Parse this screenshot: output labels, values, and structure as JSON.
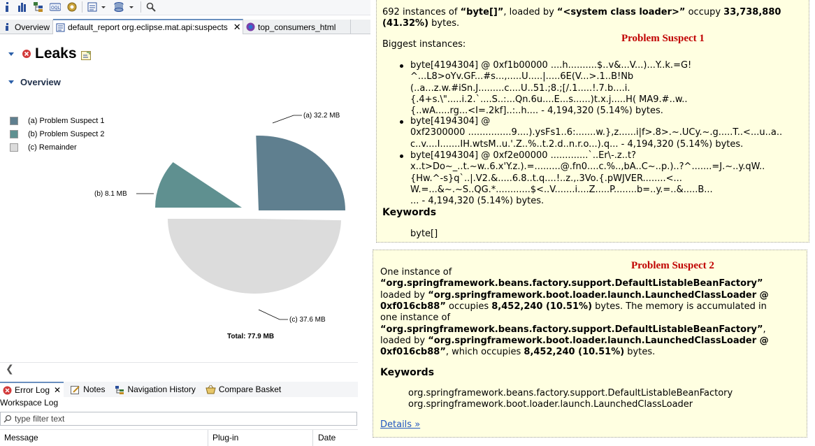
{
  "editor_tabs": {
    "overview": "Overview",
    "report": "default_report org.eclipse.mat.api:suspects",
    "consumers": "top_consumers_html"
  },
  "leaks": {
    "title": "Leaks",
    "overview": "Overview"
  },
  "legend": [
    {
      "label": "(a)  Problem Suspect 1",
      "color": "#5f7f8f"
    },
    {
      "label": "(b)  Problem Suspect 2",
      "color": "#5f9090"
    },
    {
      "label": "(c)  Remainder",
      "color": "#dcdcdc"
    }
  ],
  "chart_data": {
    "type": "pie",
    "slices": [
      {
        "label": "(a)  32.2 MB",
        "value": 32.2,
        "color": "#5f7f8f"
      },
      {
        "label": "(b)  8.1 MB",
        "value": 8.1,
        "color": "#5f9090"
      },
      {
        "label": "(c)  37.6 MB",
        "value": 37.6,
        "color": "#dcdcdc"
      }
    ],
    "total": "Total: 77.9 MB"
  },
  "bottom_tabs": {
    "error_log": "Error Log",
    "notes": "Notes",
    "nav_history": "Navigation History",
    "compare_basket": "Compare Basket"
  },
  "workspace_log": "Workspace Log",
  "filter_placeholder": "type filter text",
  "log_columns": {
    "message": "Message",
    "plugin": "Plug-in",
    "date": "Date"
  },
  "suspect1": {
    "label": "Problem Suspect 1",
    "intro_a": "692 instances of ",
    "intro_cls": "“byte[]”",
    "intro_b": ", loaded by ",
    "intro_loader": "“<system class loader>”",
    "intro_c": " occupy ",
    "intro_size": "33,738,880",
    "intro_pct": "(41.32%)",
    "intro_d": " bytes.",
    "biggest": "Biggest instances:",
    "instances": [
      [
        "byte[4194304] @ 0xf1b00000 ....h..........$..v&...V...)...Y..k.=G!",
        "^...L8>oYv.GF...#s...,.....U.....|.....6E(V...>.1..B!Nb",
        "(..a...z.w.#iSn.J.........c....U..51.;8.;[/.1.....!.7.b....i.",
        "{.4+s.\\\".....i.2.`....S..:...Qn.6u....E...s......)t.x.j.....H( MA9.#..w..",
        "{..wA.....rg...<I=.2kf]..:..h.... - 4,194,320 (5.14%) bytes."
      ],
      [
        "byte[4194304] @",
        "0xf2300000 ...............9....).ysFs1..6:.......w.},z......i|f>.8>.~.UCy.~.g.....T..<...u..a..",
        "c..v....I.......IH.wtsM..u.'.Z..%..t.2.d..n.r.o...).q... - 4,194,320 (5.14%) bytes."
      ],
      [
        "byte[4194304] @ 0xf2e00000 .............`..Er\\-.z..t?",
        "x..t>Do~_..t.~w..6.x'Y.z.).=.........@.fn0....c.%..,bA..C~..p.)..?^.......=J.~..y.qW..",
        "{Hw.^-s}q`..|.V2.&.....6.8..t.q....!..z.,.3Vo.{.pWJVER........<...",
        "W.=...&~.~S..QG.*............$<..V.......i....Z.....P........b=..y.=..&.....B...",
        "... - 4,194,320 (5.14%) bytes."
      ]
    ],
    "keywords_title": "Keywords",
    "keywords": [
      "byte[]"
    ]
  },
  "suspect2": {
    "label": "Problem Suspect 2",
    "lines": [
      {
        "parts": [
          {
            "t": "One instance of",
            "b": false
          }
        ]
      },
      {
        "parts": [
          {
            "t": "“org.springframework.beans.factory.support.DefaultListableBeanFactory”",
            "b": true
          }
        ]
      },
      {
        "parts": [
          {
            "t": "loaded by ",
            "b": false
          },
          {
            "t": "“org.springframework.boot.loader.launch.LaunchedClassLoader @",
            "b": true
          }
        ]
      },
      {
        "parts": [
          {
            "t": "0xf016cb88”",
            "b": true
          },
          {
            "t": " occupies ",
            "b": false
          },
          {
            "t": "8,452,240 (10.51%)",
            "b": true
          },
          {
            "t": " bytes. The memory is accumulated in",
            "b": false
          }
        ]
      },
      {
        "parts": [
          {
            "t": "one instance of",
            "b": false
          }
        ]
      },
      {
        "parts": [
          {
            "t": "“org.springframework.beans.factory.support.DefaultListableBeanFactory”",
            "b": true
          },
          {
            "t": ",",
            "b": false
          }
        ]
      },
      {
        "parts": [
          {
            "t": "loaded by ",
            "b": false
          },
          {
            "t": "“org.springframework.boot.loader.launch.LaunchedClassLoader @",
            "b": true
          }
        ]
      },
      {
        "parts": [
          {
            "t": "0xf016cb88”",
            "b": true
          },
          {
            "t": ", which occupies ",
            "b": false
          },
          {
            "t": "8,452,240 (10.51%)",
            "b": true
          },
          {
            "t": " bytes.",
            "b": false
          }
        ]
      }
    ],
    "keywords_title": "Keywords",
    "keywords": [
      "org.springframework.beans.factory.support.DefaultListableBeanFactory",
      "org.springframework.boot.loader.launch.LaunchedClassLoader"
    ],
    "details": "Details »"
  }
}
